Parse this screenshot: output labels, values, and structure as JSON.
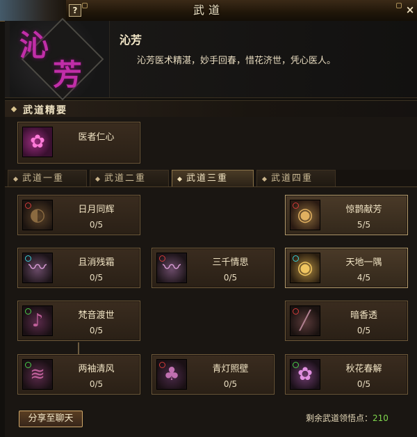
{
  "window": {
    "title": "武道",
    "help_label": "?",
    "close_label": "×"
  },
  "character": {
    "portrait_text": [
      "沁",
      "芳"
    ],
    "name": "沁芳",
    "description": "沁芳医术精湛，妙手回春，惜花济世，凭心医人。"
  },
  "essentials": {
    "title": "武道精要",
    "skill": {
      "name": "医者仁心",
      "icon": "heal-spirit-icon"
    }
  },
  "tabs": [
    {
      "label": "武道一重",
      "selected": false
    },
    {
      "label": "武道二重",
      "selected": false
    },
    {
      "label": "武道三重",
      "selected": true
    },
    {
      "label": "武道四重",
      "selected": false
    }
  ],
  "skills": {
    "riyue": {
      "name": "日月同辉",
      "level": "0/5",
      "icon": "sun-moon-icon"
    },
    "jingyan": {
      "name": "惊鹊献芳",
      "level": "5/5",
      "icon": "magpie-icon"
    },
    "qiexiao": {
      "name": "且消残霜",
      "level": "0/5",
      "icon": "frost-icon"
    },
    "sanqian": {
      "name": "三千情思",
      "level": "0/5",
      "icon": "threads-icon"
    },
    "tiandi": {
      "name": "天地一隅",
      "level": "4/5",
      "icon": "earth-icon"
    },
    "fanyin": {
      "name": "梵音渡世",
      "level": "0/5",
      "icon": "chant-icon"
    },
    "anxiang": {
      "name": "暗香透",
      "level": "0/5",
      "icon": "fragrance-icon"
    },
    "liangxiu": {
      "name": "两袖清风",
      "level": "0/5",
      "icon": "sleeves-icon"
    },
    "qingdeng": {
      "name": "青灯照壁",
      "level": "0/5",
      "icon": "lamp-icon"
    },
    "qiuhua": {
      "name": "秋花春解",
      "level": "0/5",
      "icon": "blossom-icon"
    }
  },
  "footer": {
    "share_label": "分享至聊天",
    "remaining_label": "剩余武道领悟点：",
    "remaining_value": "210"
  },
  "colors": {
    "accent_gold": "#c8a86a",
    "remaining_green": "#7fd64d",
    "calligraphy_magenta": "#c12ea8"
  }
}
